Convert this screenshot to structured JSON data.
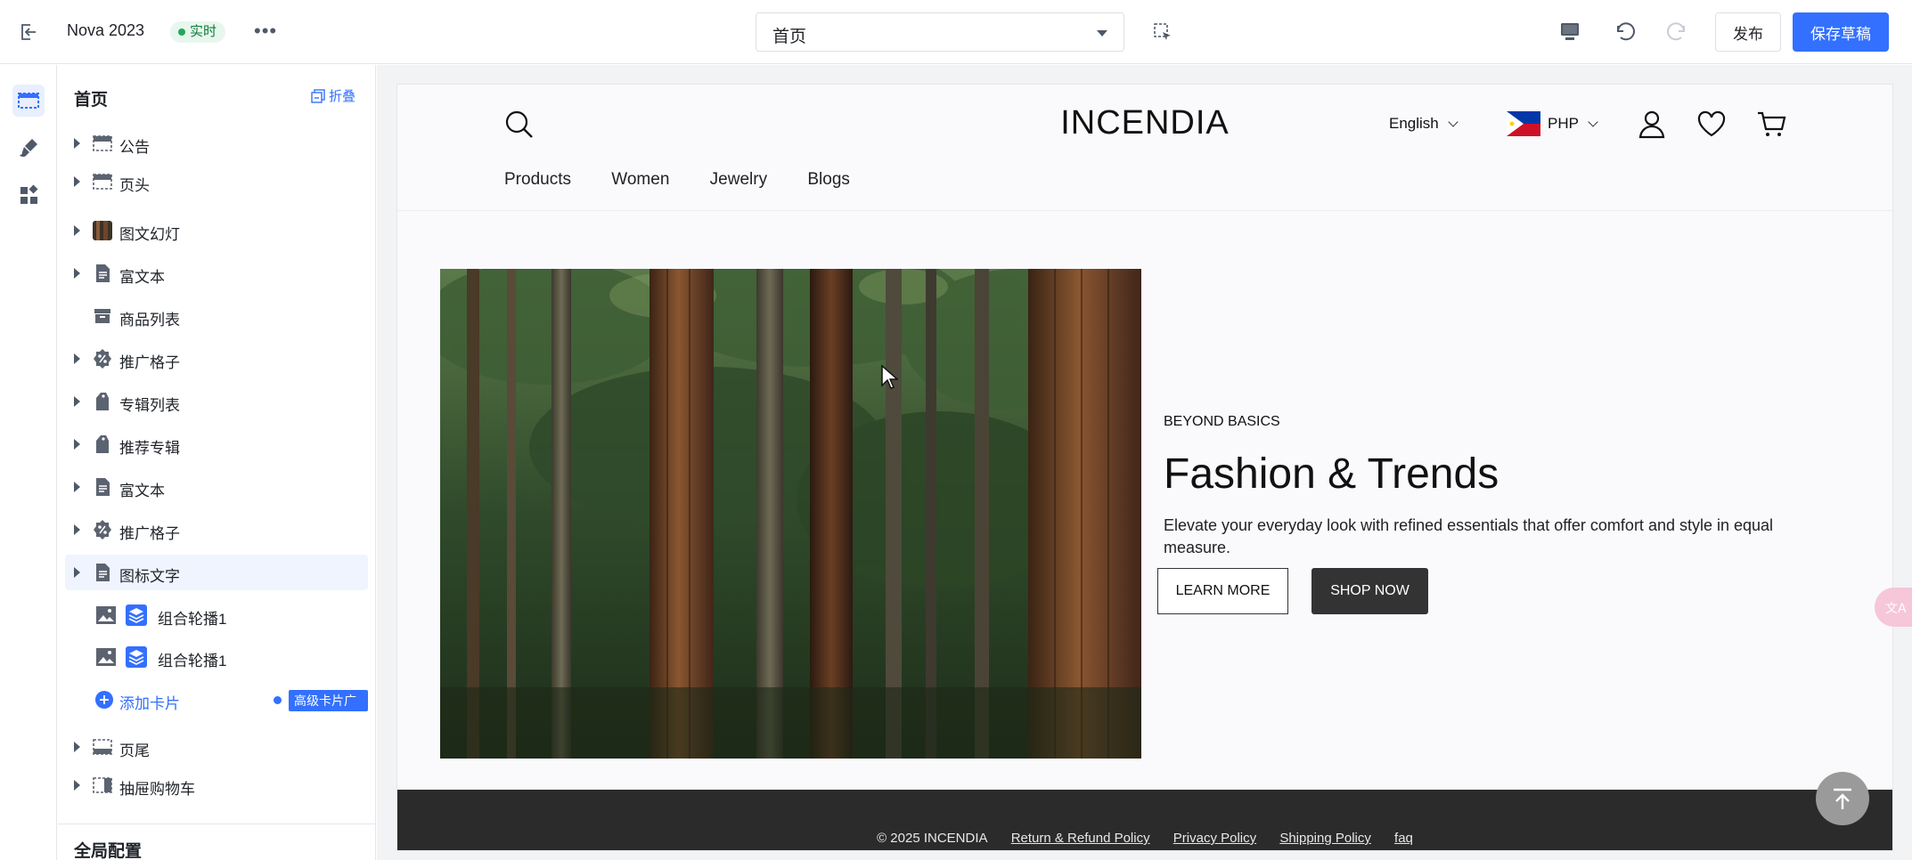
{
  "topbar": {
    "app_title": "Nova 2023",
    "live_badge": "实时",
    "more": "•••",
    "page_select": "首页",
    "publish_label": "发布",
    "save_label": "保存草稿"
  },
  "sidebar": {
    "title": "首页",
    "collapse_label": "折叠",
    "items": [
      {
        "label": "公告",
        "icon": "section-icon"
      },
      {
        "label": "页头",
        "icon": "section-icon"
      },
      {
        "label": "图文幻灯",
        "icon": "image-thumb-icon"
      },
      {
        "label": "富文本",
        "icon": "document-icon"
      },
      {
        "label": "商品列表",
        "icon": "product-box-icon"
      },
      {
        "label": "推广格子",
        "icon": "discount-icon"
      },
      {
        "label": "专辑列表",
        "icon": "tag-icon"
      },
      {
        "label": "推荐专辑",
        "icon": "tag-icon"
      },
      {
        "label": "富文本",
        "icon": "document-icon"
      },
      {
        "label": "推广格子",
        "icon": "discount-icon"
      },
      {
        "label": "图标文字",
        "icon": "document-icon"
      }
    ],
    "sub_items": [
      {
        "label": "组合轮播1"
      },
      {
        "label": "组合轮播1"
      }
    ],
    "add_card": "添加卡片",
    "adv_tag": "高级卡片广场",
    "footer_items": [
      {
        "label": "页尾"
      },
      {
        "label": "抽屉购物车"
      }
    ],
    "section_global": "全局配置"
  },
  "store": {
    "brand": "INCENDIA",
    "language": "English",
    "currency": "PHP",
    "nav": [
      "Products",
      "Women",
      "Jewelry",
      "Blogs"
    ],
    "hero": {
      "eyebrow": "BEYOND BASICS",
      "headline": "Fashion & Trends",
      "body": "Elevate your everyday look with refined essentials that offer comfort and style in equal measure.",
      "learn_more": "LEARN MORE",
      "shop_now": "SHOP NOW"
    },
    "footer": {
      "copyright": "© 2025 INCENDIA",
      "links": [
        "Return & Refund Policy",
        "Privacy Policy",
        "Shipping Policy",
        "faq"
      ]
    }
  },
  "colors": {
    "accent": "#3370ff",
    "live_green": "#22a85a",
    "footer_bg": "#2b2b2b",
    "shop_btn": "#333333"
  }
}
